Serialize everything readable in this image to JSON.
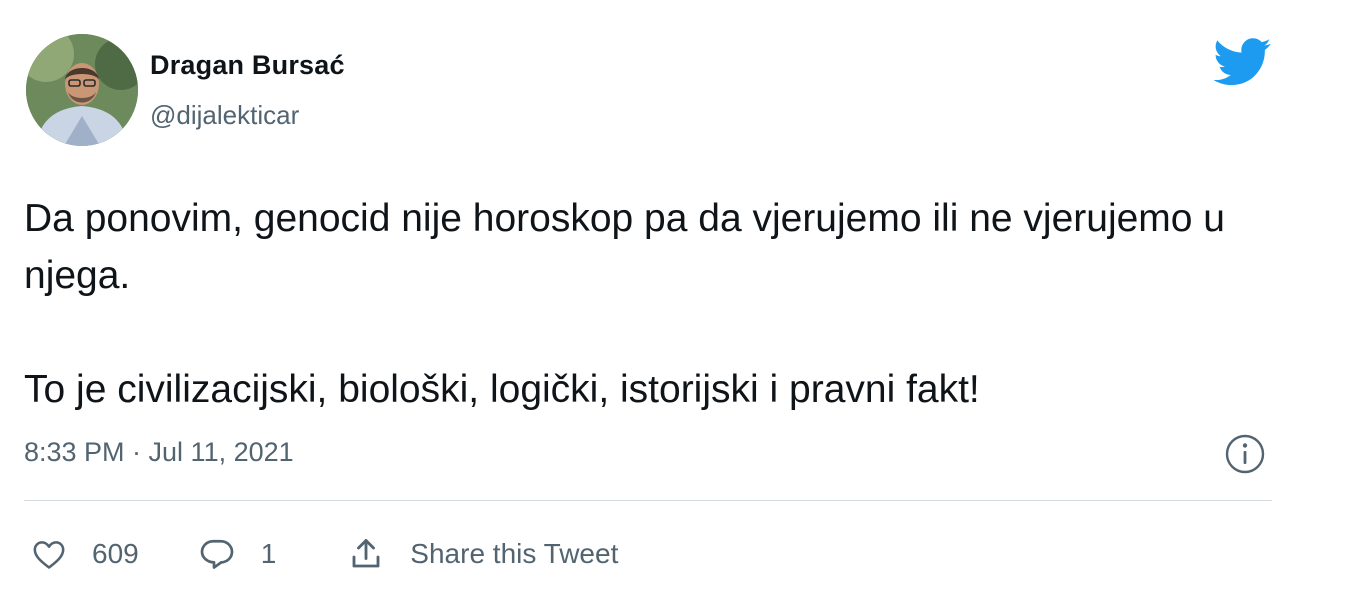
{
  "tweet": {
    "author": {
      "display_name": "Dragan Bursać",
      "handle": "@dijalekticar"
    },
    "text_paragraphs": [
      "Da ponovim, genocid nije horoskop pa da vjerujemo ili ne vjerujemo u njega.",
      "To je civilizacijski, biološki, logički, istorijski i pravni fakt!"
    ],
    "timestamp": "8:33 PM · Jul 11, 2021",
    "actions": {
      "like_count": "609",
      "reply_count": "1",
      "share_label": "Share this Tweet"
    }
  },
  "icons": {
    "brand": "twitter-bird-icon",
    "info": "info-icon",
    "like": "heart-icon",
    "reply": "speech-bubble-icon",
    "share": "share-icon"
  },
  "colors": {
    "brand": "#1d9bf0",
    "text": "#0f1419",
    "secondary": "#536471",
    "divider": "#cfd9de"
  }
}
